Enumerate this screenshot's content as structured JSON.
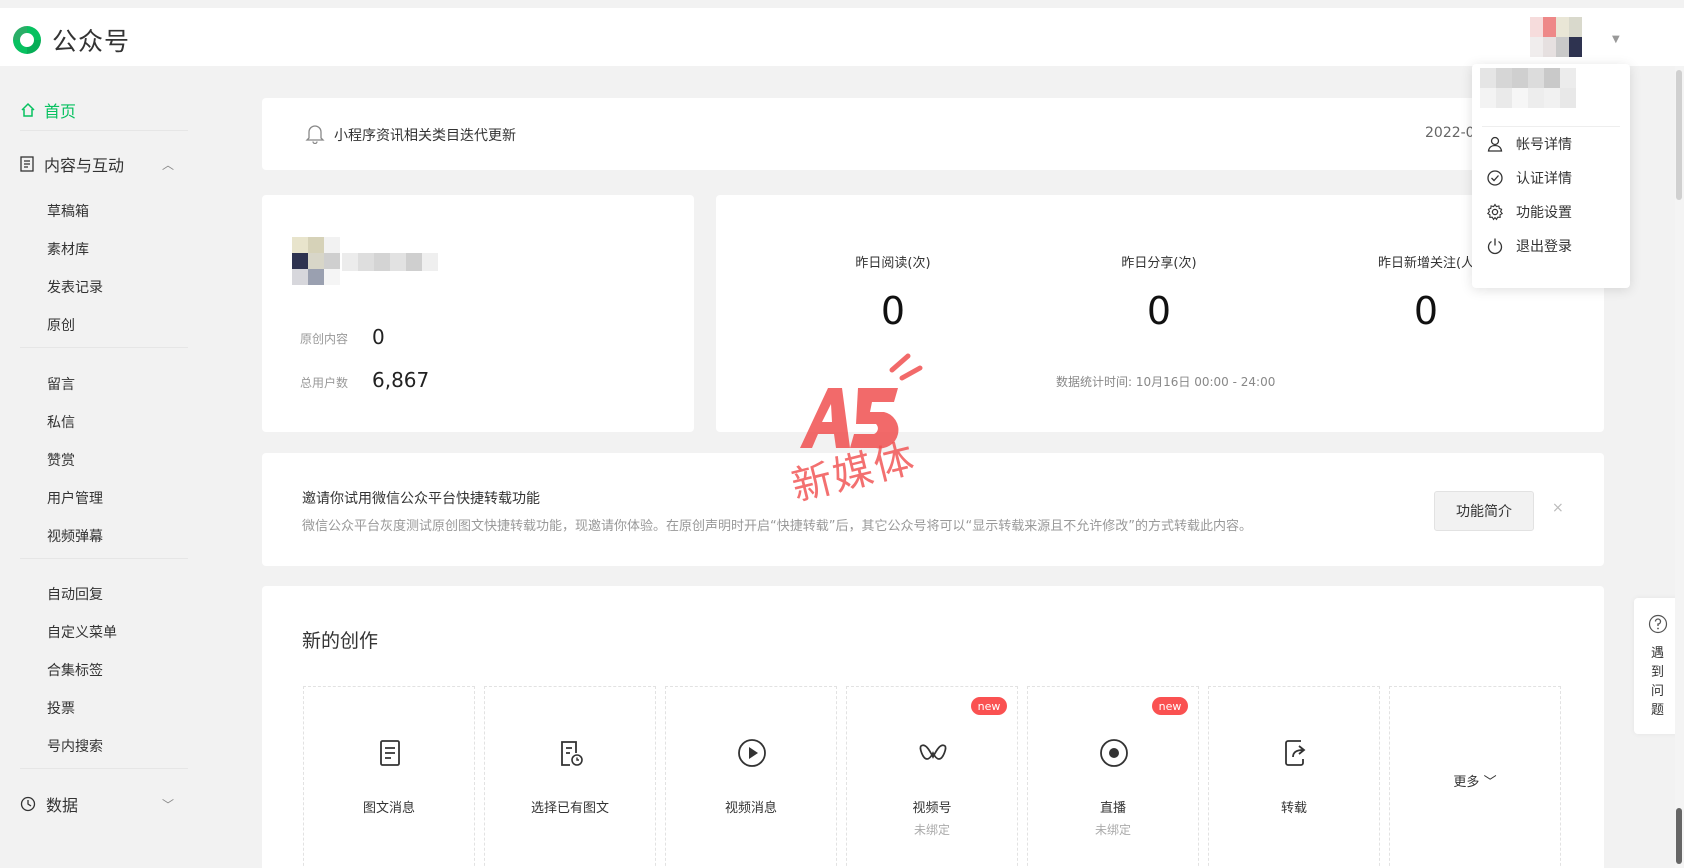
{
  "app": {
    "title": "公众号",
    "brand_color": "#07c160"
  },
  "sidebar": {
    "home": "首页",
    "content_section": "内容与互动",
    "content_items": [
      "草稿箱",
      "素材库",
      "发表记录",
      "原创"
    ],
    "interact_items": [
      "留言",
      "私信",
      "赞赏",
      "用户管理",
      "视频弹幕"
    ],
    "tools_items": [
      "自动回复",
      "自定义菜单",
      "合集标签",
      "投票",
      "号内搜索"
    ],
    "data_section": "数据"
  },
  "notice": {
    "text": "小程序资讯相关类目迭代更新",
    "date": "2022-0"
  },
  "profile": {
    "original_label": "原创内容",
    "original_value": "0",
    "users_label": "总用户数",
    "users_value": "6,867"
  },
  "stats": {
    "read_label": "昨日阅读(次)",
    "read_value": "0",
    "share_label": "昨日分享(次)",
    "share_value": "0",
    "follow_label": "昨日新增关注(人",
    "follow_value": "0",
    "note": "数据统计时间: 10月16日 00:00 - 24:00"
  },
  "invite": {
    "title": "邀请你试用微信公众平台快捷转载功能",
    "desc": "微信公众平台灰度测试原创图文快捷转载功能，现邀请你体验。在原创声明时开启“快捷转载”后，其它公众号将可以“显示转载来源且不允许修改”的方式转载此内容。",
    "button": "功能简介",
    "close": "×"
  },
  "create": {
    "title": "新的创作",
    "tiles": [
      {
        "label": "图文消息",
        "icon": "article-icon"
      },
      {
        "label": "选择已有图文",
        "icon": "existing-article-icon"
      },
      {
        "label": "视频消息",
        "icon": "play-icon"
      },
      {
        "label": "视频号",
        "sub": "未绑定",
        "badge": "new",
        "icon": "channels-icon"
      },
      {
        "label": "直播",
        "sub": "未绑定",
        "badge": "new",
        "icon": "live-icon"
      },
      {
        "label": "转载",
        "icon": "repost-icon"
      }
    ],
    "more": "更多"
  },
  "dropdown": {
    "items": [
      "帐号详情",
      "认证详情",
      "功能设置",
      "退出登录"
    ]
  },
  "help": {
    "text": "遇到问题"
  },
  "watermark": {
    "text": "新媒体"
  }
}
